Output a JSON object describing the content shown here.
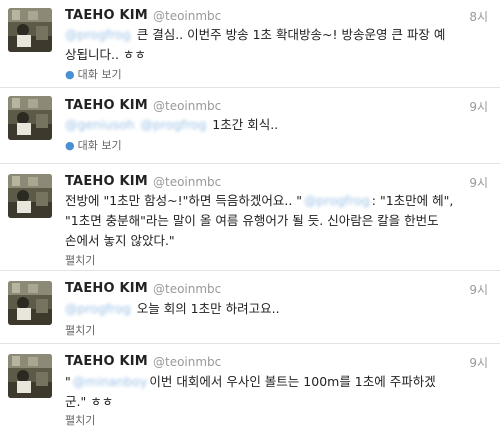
{
  "tweets": [
    {
      "name": "TAEHO KIM",
      "handle": "@teoinmbc",
      "time": "8시",
      "mentions": [
        "@progfrog"
      ],
      "line1": "큰 결심.. 이번주 방송 1초 확대방송~! 방송운영 큰 파장 예",
      "line2": "상됩니다.. ㅎㅎ",
      "action": "대화 보기"
    },
    {
      "name": "TAEHO KIM",
      "handle": "@teoinmbc",
      "time": "9시",
      "mentions": [
        "@geniusoh",
        "@progfrog"
      ],
      "line1": "1초간 회식..",
      "action": "대화 보기"
    },
    {
      "name": "TAEHO KIM",
      "handle": "@teoinmbc",
      "time": "9시",
      "line1a": "전방에 \"1초만 함성~!\"하면 득음하겠어요.. \"",
      "mention_inline": "@progfrog",
      "line1b": ": \"1초만에 헤\",",
      "line2": "\"1초면 충분해\"라는 말이 올 여름 유행어가 될 듯. 신아람은 칼을 한번도",
      "line3": "손에서 놓지 않았다.\"",
      "action": "펼치기"
    },
    {
      "name": "TAEHO KIM",
      "handle": "@teoinmbc",
      "time": "9시",
      "mentions": [
        "@progfrog"
      ],
      "line1": "오늘 회의 1초만 하려고요..",
      "action": "펼치기"
    },
    {
      "name": "TAEHO KIM",
      "handle": "@teoinmbc",
      "time": "9시",
      "line1a": "\"",
      "mention_inline": "@minanboy",
      "line1b": "이번 대회에서 우사인 볼트는 100m를 1초에 주파하겠",
      "line2": "군.\" ㅎㅎ",
      "action": "펼치기"
    }
  ]
}
